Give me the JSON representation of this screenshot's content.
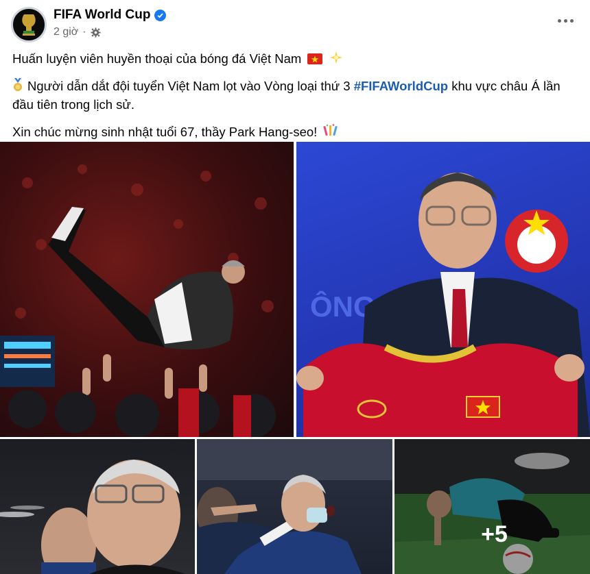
{
  "post": {
    "page_name": "FIFA World Cup",
    "time": "2 giờ",
    "icons": {
      "verified": "verified-badge-icon",
      "audience": "gear-icon",
      "more": "more-options-icon"
    },
    "caption": {
      "line1": "Huấn luyện viên huyền thoại của bóng đá Việt Nam",
      "line2_before": "Người dẫn dắt đội tuyển Việt Nam lọt vào Vòng loại thứ 3",
      "hashtag": "#FIFAWorldCup",
      "line2_after": "khu vực châu Á lần đầu tiên trong lịch sử.",
      "line3": "Xin chúc mừng sinh nhật tuổi 67, thầy Park Hang-seo!"
    },
    "emojis": [
      "vietnam-flag-icon",
      "sparkle-star-icon",
      "medal-icon",
      "confetti-icon"
    ],
    "photos": [
      {
        "name": "photo-celebration-toss"
      },
      {
        "name": "photo-holding-jersey"
      },
      {
        "name": "photo-coach-closeup"
      },
      {
        "name": "photo-coach-shouting"
      },
      {
        "name": "photo-coach-kneeling",
        "more_count": "+5"
      }
    ]
  },
  "colors": {
    "accent": "#1877f2",
    "hashtag": "#1b5eb0",
    "secondary_text": "#65676b"
  }
}
